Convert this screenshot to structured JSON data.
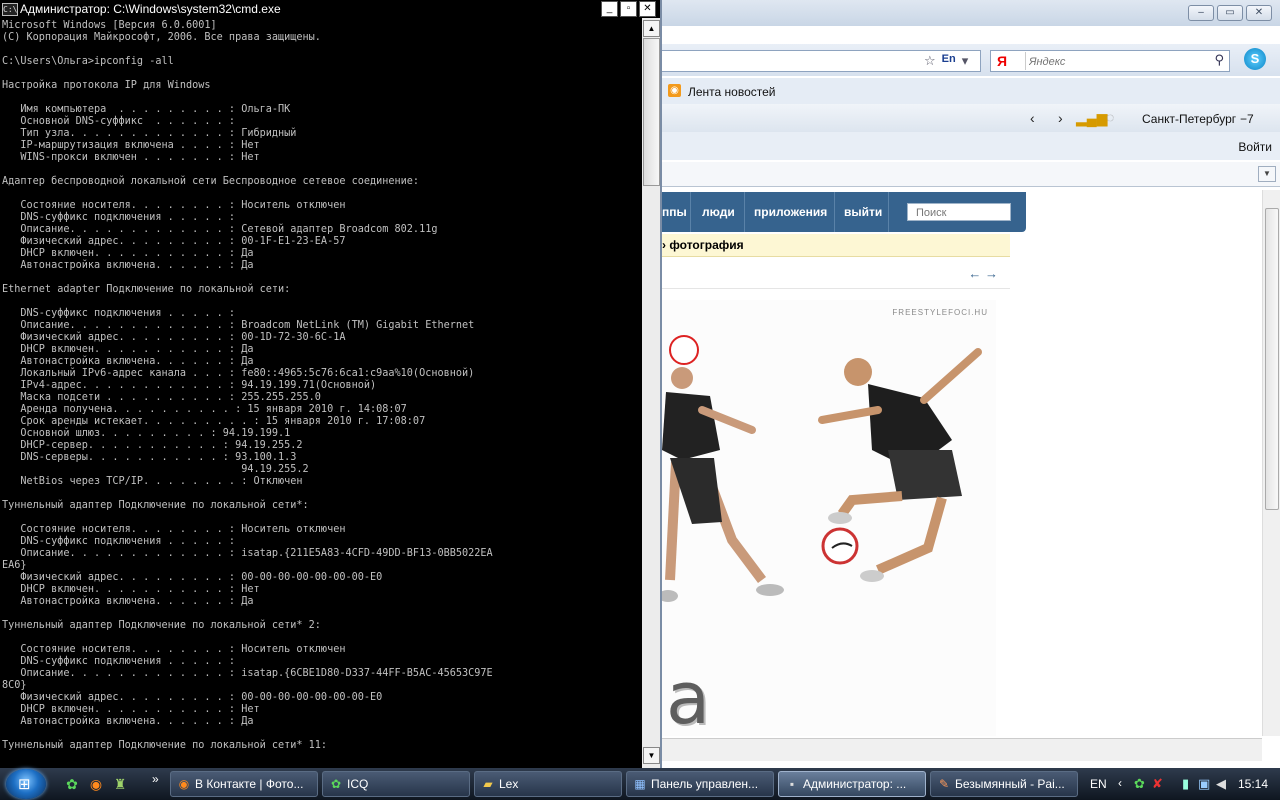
{
  "browser": {
    "search_placeholder": "Яндекс",
    "lang_label": "En",
    "ya_logo": "Я",
    "favorites_link": "Лента новостей",
    "city": "Санкт-Петербург",
    "temperature": "−7",
    "login_link": "Войти",
    "vk_nav": [
      "ппы",
      "люди",
      "приложения",
      "выйти"
    ],
    "vk_search_placeholder": "Поиск",
    "photo_header": "› фотография",
    "photo_arrows": "← →",
    "watermark": "FREESTYLEFOCI.HU",
    "photo_big_text": "a Labdát"
  },
  "cmd": {
    "title": "Администратор: C:\\Windows\\system32\\cmd.exe",
    "icon_label": "C:\\",
    "lines": [
      "Microsoft Windows [Версия 6.0.6001]",
      "(C) Корпорация Майкрософт, 2006. Все права защищены.",
      "",
      "C:\\Users\\Ольга>ipconfig -all",
      "",
      "Настройка протокола IP для Windows",
      "",
      "   Имя компьютера  . . . . . . . . . : Ольга-ПК",
      "   Основной DNS-суффикс  . . . . . . :",
      "   Тип узла. . . . . . . . . . . . . : Гибридный",
      "   IP-маршрутизация включена . . . . : Нет",
      "   WINS-прокси включен . . . . . . . : Нет",
      "",
      "Адаптер беспроводной локальной сети Беспроводное сетевое соединение:",
      "",
      "   Состояние носителя. . . . . . . . : Носитель отключен",
      "   DNS-суффикс подключения . . . . . :",
      "   Описание. . . . . . . . . . . . . : Сетевой адаптер Broadcom 802.11g",
      "   Физический адрес. . . . . . . . . : 00-1F-E1-23-EA-57",
      "   DHCP включен. . . . . . . . . . . : Да",
      "   Автонастройка включена. . . . . . : Да",
      "",
      "Ethernet adapter Подключение по локальной сети:",
      "",
      "   DNS-суффикс подключения . . . . . :",
      "   Описание. . . . . . . . . . . . . : Broadcom NetLink (TM) Gigabit Ethernet",
      "   Физический адрес. . . . . . . . . : 00-1D-72-30-6C-1A",
      "   DHCP включен. . . . . . . . . . . : Да",
      "   Автонастройка включена. . . . . . : Да",
      "   Локальный IPv6-адрес канала . . . : fe80::4965:5c76:6ca1:c9aa%10(Основной)",
      "   IPv4-адрес. . . . . . . . . . . . : 94.19.199.71(Основной)",
      "   Маска подсети . . . . . . . . . . : 255.255.255.0",
      "   Аренда получена. . . . . . . . . . : 15 января 2010 г. 14:08:07",
      "   Срок аренды истекает. . . . . . . . . : 15 января 2010 г. 17:08:07",
      "   Основной шлюз. . . . . . . . . : 94.19.199.1",
      "   DHCP-сервер. . . . . . . . . . . : 94.19.255.2",
      "   DNS-серверы. . . . . . . . . . . : 93.100.1.3",
      "                                       94.19.255.2",
      "   NetBios через TCP/IP. . . . . . . . : Отключен",
      "",
      "Туннельный адаптер Подключение по локальной сети*:",
      "",
      "   Состояние носителя. . . . . . . . : Носитель отключен",
      "   DNS-суффикс подключения . . . . . :",
      "   Описание. . . . . . . . . . . . . : isatap.{211E5A83-4CFD-49DD-BF13-0BB5022EA",
      "EA6}",
      "   Физический адрес. . . . . . . . . : 00-00-00-00-00-00-00-E0",
      "   DHCP включен. . . . . . . . . . . : Нет",
      "   Автонастройка включена. . . . . . : Да",
      "",
      "Туннельный адаптер Подключение по локальной сети* 2:",
      "",
      "   Состояние носителя. . . . . . . . : Носитель отключен",
      "   DNS-суффикс подключения . . . . . :",
      "   Описание. . . . . . . . . . . . . : isatap.{6CBE1D80-D337-44FF-B5AC-45653C97E",
      "8C0}",
      "   Физический адрес. . . . . . . . . : 00-00-00-00-00-00-00-E0",
      "   DHCP включен. . . . . . . . . . . : Нет",
      "   Автонастройка включена. . . . . . : Да",
      "",
      "Туннельный адаптер Подключение по локальной сети* 11:"
    ]
  },
  "taskbar": {
    "more_label": "»",
    "buttons": [
      {
        "label": "В Контакте | Фото...",
        "icon": "firefox-icon",
        "active": false
      },
      {
        "label": "ICQ",
        "icon": "icq-icon",
        "active": false
      },
      {
        "label": "Lex",
        "icon": "folder-icon",
        "active": false
      },
      {
        "label": "Панель управлен...",
        "icon": "control-panel-icon",
        "active": false
      },
      {
        "label": "Администратор: ...",
        "icon": "cmd-icon",
        "active": true
      },
      {
        "label": "Безымянный - Pai...",
        "icon": "paint-icon",
        "active": false
      }
    ],
    "lang": "EN",
    "clock": "15:14"
  },
  "colors": {
    "console_bg": "#000000",
    "console_text": "#c0c0c0",
    "vk_blue": "#36638e"
  }
}
